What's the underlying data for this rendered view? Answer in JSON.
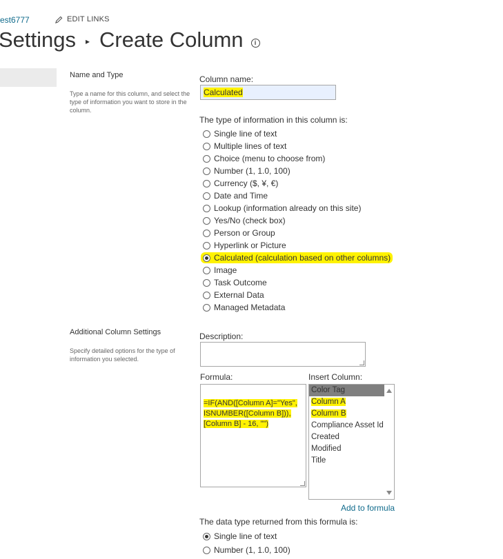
{
  "header": {
    "site_link": "est6777",
    "edit_links": "EDIT LINKS",
    "breadcrumb_parent": "Settings",
    "breadcrumb_separator": "▸",
    "page_title": "Create Column",
    "info_icon_glyph": "i"
  },
  "name_and_type": {
    "title": "Name and Type",
    "description": "Type a name for this column, and select the type of information you want to store in the column.",
    "column_name_label": "Column name:",
    "column_name_value": "Calculated",
    "type_label": "The type of information in this column is:",
    "types": [
      {
        "label": "Single line of text",
        "checked": false
      },
      {
        "label": "Multiple lines of text",
        "checked": false
      },
      {
        "label": "Choice (menu to choose from)",
        "checked": false
      },
      {
        "label": "Number (1, 1.0, 100)",
        "checked": false
      },
      {
        "label": "Currency ($, ¥, €)",
        "checked": false
      },
      {
        "label": "Date and Time",
        "checked": false
      },
      {
        "label": "Lookup (information already on this site)",
        "checked": false
      },
      {
        "label": "Yes/No (check box)",
        "checked": false
      },
      {
        "label": "Person or Group",
        "checked": false
      },
      {
        "label": "Hyperlink or Picture",
        "checked": false
      },
      {
        "label": "Calculated (calculation based on other columns)",
        "checked": true
      },
      {
        "label": "Image",
        "checked": false
      },
      {
        "label": "Task Outcome",
        "checked": false
      },
      {
        "label": "External Data",
        "checked": false
      },
      {
        "label": "Managed Metadata",
        "checked": false
      }
    ]
  },
  "additional": {
    "title": "Additional Column Settings",
    "description": "Specify detailed options for the type of information you selected.",
    "description_label": "Description:",
    "description_value": "",
    "formula_label": "Formula:",
    "formula_lines": [
      "=IF(AND([Column A]=\"Yes\",",
      "ISNUMBER([Column B])),",
      "[Column B] - 16, \"\")"
    ],
    "insert_column_label": "Insert Column:",
    "insert_columns": [
      "Color Tag",
      "Column A",
      "Column B",
      "Compliance Asset Id",
      "Created",
      "Modified",
      "Title"
    ],
    "selected_insert_column": "Color Tag",
    "add_to_formula": "Add to formula",
    "return_type_label": "The data type returned from this formula is:",
    "return_types": [
      {
        "label": "Single line of text",
        "checked": true
      },
      {
        "label": "Number (1, 1.0, 100)",
        "checked": false
      }
    ]
  },
  "colors": {
    "highlight": "#fff200",
    "link": "#0f6a8b",
    "input_fill": "#e8f0fe",
    "list_selected": "#7f7f7f"
  }
}
